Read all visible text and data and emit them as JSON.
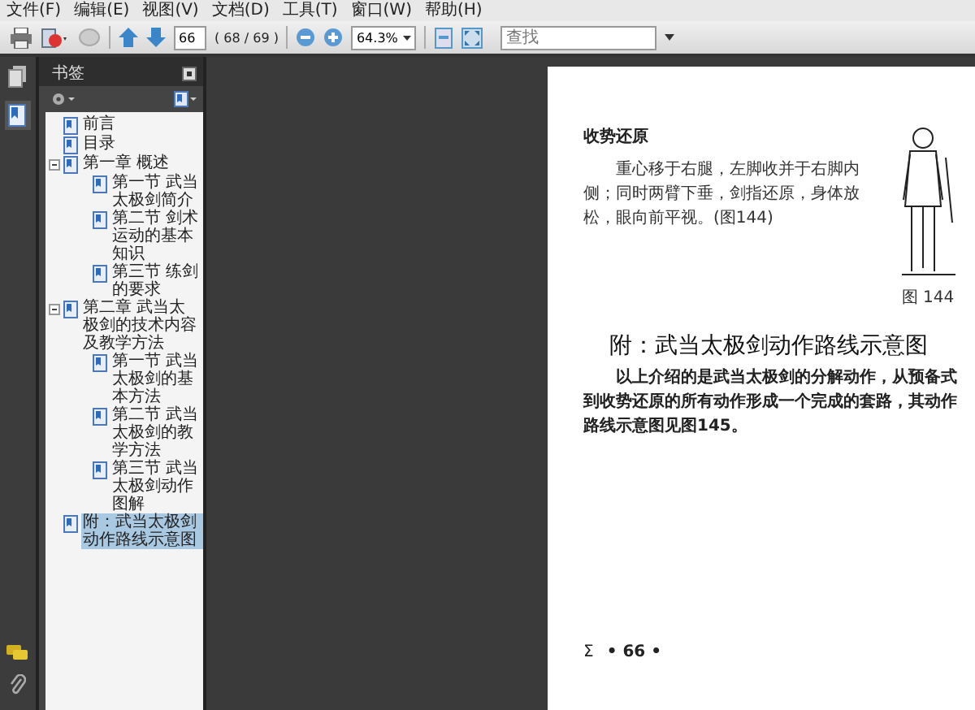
{
  "menu": [
    "文件(F)",
    "编辑(E)",
    "视图(V)",
    "文档(D)",
    "工具(T)",
    "窗口(W)",
    "帮助(H)"
  ],
  "toolbar": {
    "page_field": "66",
    "page_count": "( 68 / 69 )",
    "zoom": "64.3%",
    "search": {
      "placeholder": "查找"
    }
  },
  "bookmarks_panel": {
    "title": "书签",
    "items": [
      {
        "label": "前言",
        "selected": false
      },
      {
        "label": "目录",
        "selected": false
      },
      {
        "label": "第一章  概述",
        "selected": false,
        "expanded": true,
        "children": [
          {
            "label": "第一节  武当太极剑简介",
            "selected": false
          },
          {
            "label": "第二节  剑术运动的基本知识",
            "selected": false
          },
          {
            "label": "第三节  练剑的要求",
            "selected": false
          }
        ]
      },
      {
        "label": "第二章  武当太极剑的技术内容及教学方法",
        "selected": false,
        "expanded": true,
        "children": [
          {
            "label": "第一节  武当太极剑的基本方法",
            "selected": false
          },
          {
            "label": "第二节  武当太极剑的教学方法",
            "selected": false
          },
          {
            "label": "第三节  武当太极剑动作图解",
            "selected": false
          }
        ]
      },
      {
        "label": "附：武当太极剑动作路线示意图",
        "selected": true
      }
    ]
  },
  "document_page": {
    "subheading": "收势还原",
    "paragraph_1": "重心移于右腿，左脚收并于右脚内侧；同时两臂下垂，剑指还原，身体放松，眼向前平视。(图144)",
    "figure_caption": "图 144",
    "heading": "附：武当太极剑动作路线示意图",
    "paragraph_2": "以上介绍的是武当太极剑的分解动作，从预备式到收势还原的所有动作形成一个完成的套路，其动作路线示意图见图145。",
    "footer_mark": "Σ",
    "page_number": "• 66 •"
  }
}
